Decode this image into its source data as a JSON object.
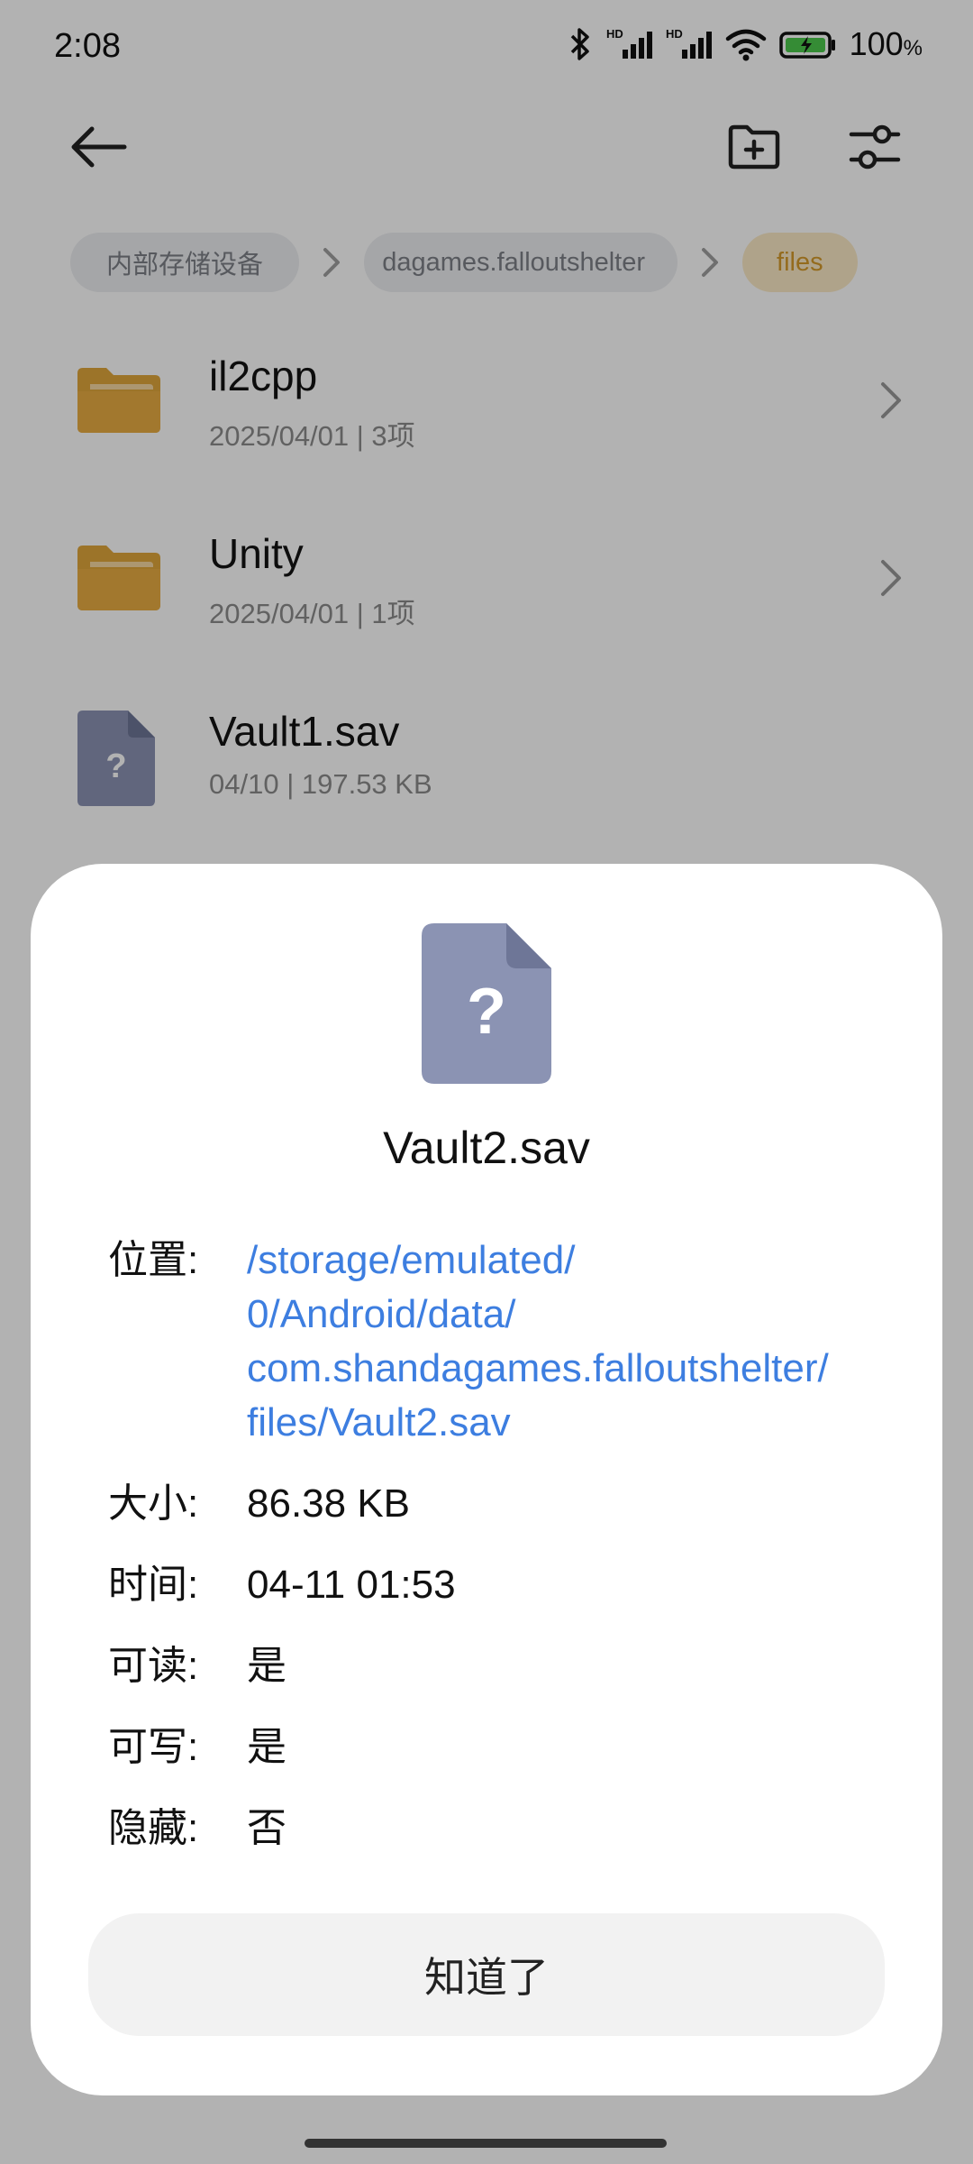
{
  "status_bar": {
    "time": "2:08",
    "battery_percent": "100",
    "battery_unit": "%"
  },
  "breadcrumb": {
    "items": [
      "内部存储设备",
      "dagames.falloutshelter",
      "files"
    ]
  },
  "files": [
    {
      "name": "il2cpp",
      "meta": "2025/04/01 | 3项",
      "icon": "folder-icon"
    },
    {
      "name": "Unity",
      "meta": "2025/04/01 | 1项",
      "icon": "folder-icon"
    },
    {
      "name": "Vault1.sav",
      "meta": "04/10 | 197.53 KB",
      "icon": "unknown-file-icon"
    }
  ],
  "dialog": {
    "icon_glyph": "?",
    "title": "Vault2.sav",
    "location_label": "位置:",
    "location_value": "/storage/emulated/0/Android/data/com.shandagames.falloutshelter/files/Vault2.sav",
    "location_lines": [
      "/storage/emulated/",
      "0/Android/data/",
      "com.shandagames.falloutshelter/",
      "files/Vault2.sav"
    ],
    "size_label": "大小:",
    "size_value": "86.38 KB",
    "time_label": "时间:",
    "time_value": "04-11 01:53",
    "readable_label": "可读:",
    "readable_value": "是",
    "writable_label": "可写:",
    "writable_value": "是",
    "hidden_label": "隐藏:",
    "hidden_value": "否",
    "ok_label": "知道了"
  },
  "colors": {
    "folder": "#e0a63c",
    "unknown_file": "#8b93b3",
    "link": "#3d7ee0",
    "breadcrumb_active": "#d49a2a",
    "battery_fill": "#4cc94c"
  }
}
